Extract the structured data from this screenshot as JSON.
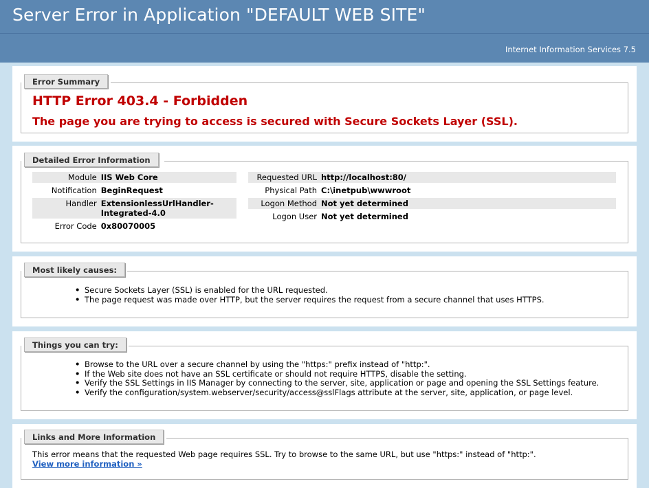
{
  "header": {
    "title": "Server Error in Application \"DEFAULT WEB SITE\"",
    "server_version": "Internet Information Services 7.5"
  },
  "summary": {
    "legend": "Error Summary",
    "title": "HTTP Error 403.4 - Forbidden",
    "description": "The page you are trying to access is secured with Secure Sockets Layer (SSL)."
  },
  "details": {
    "legend": "Detailed Error Information",
    "left": [
      {
        "label": "Module",
        "value": "IIS Web Core"
      },
      {
        "label": "Notification",
        "value": "BeginRequest"
      },
      {
        "label": "Handler",
        "value": "ExtensionlessUrlHandler-Integrated-4.0"
      },
      {
        "label": "Error Code",
        "value": "0x80070005"
      }
    ],
    "right": [
      {
        "label": "Requested URL",
        "value": "http://localhost:80/"
      },
      {
        "label": "Physical Path",
        "value": "C:\\inetpub\\wwwroot"
      },
      {
        "label": "Logon Method",
        "value": "Not yet determined"
      },
      {
        "label": "Logon User",
        "value": "Not yet determined"
      }
    ]
  },
  "causes": {
    "legend": "Most likely causes:",
    "items": [
      "Secure Sockets Layer (SSL) is enabled for the URL requested.",
      "The page request was made over HTTP, but the server requires the request from a secure channel that uses HTTPS."
    ]
  },
  "try": {
    "legend": "Things you can try:",
    "items": [
      "Browse to the URL over a secure channel by using the \"https:\" prefix instead of \"http:\".",
      "If the Web site does not have an SSL certificate or should not require HTTPS, disable the setting.",
      "Verify the SSL Settings in IIS Manager by connecting to the server, site, application or page and opening the SSL Settings feature.",
      "Verify the configuration/system.webserver/security/access@sslFlags attribute at the server, site, application, or page level."
    ]
  },
  "links": {
    "legend": "Links and More Information",
    "text": "This error means that the requested Web page requires SSL. Try to browse to the same URL, but use \"https:\" instead of \"http:\".",
    "link_label": "View more information »"
  },
  "colors": {
    "header_bg": "#5c87b2",
    "page_bg": "#cbe1ef",
    "error_red": "#c00000",
    "link_blue": "#2060c0"
  }
}
